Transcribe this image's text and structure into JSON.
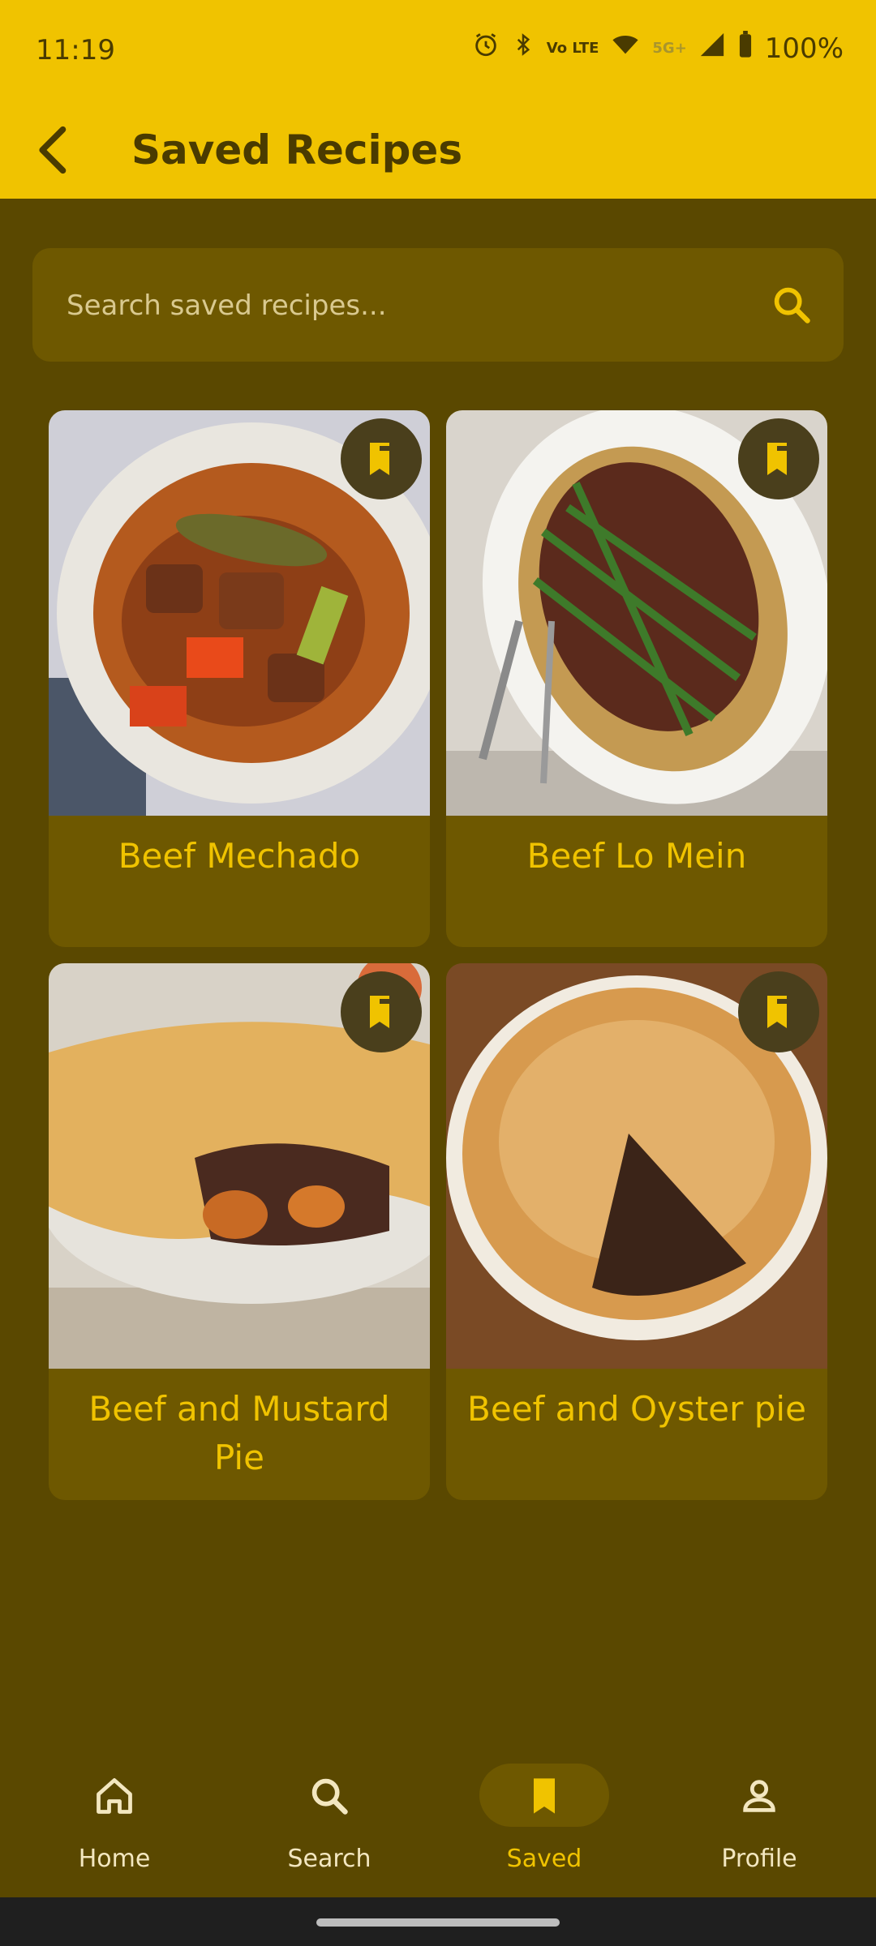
{
  "status": {
    "time": "11:19",
    "network": "5G+",
    "volte": "Vo LTE",
    "battery": "100%"
  },
  "appbar": {
    "title": "Saved Recipes"
  },
  "search": {
    "placeholder": "Search saved recipes..."
  },
  "recipes": [
    {
      "title": "Beef Mechado",
      "image": "beef-stew-bowl"
    },
    {
      "title": "Beef Lo Mein",
      "image": "beef-asparagus-noodles-platter"
    },
    {
      "title": "Beef and Mustard Pie",
      "image": "beef-pie-with-crust"
    },
    {
      "title": "Beef and Oyster pie",
      "image": "oyster-pie-cut-slice"
    }
  ],
  "nav": {
    "items": [
      {
        "label": "Home",
        "icon": "home-icon"
      },
      {
        "label": "Search",
        "icon": "search-icon"
      },
      {
        "label": "Saved",
        "icon": "bookmark-icon",
        "active": true
      },
      {
        "label": "Profile",
        "icon": "person-icon"
      }
    ]
  },
  "colors": {
    "accent": "#f0c300",
    "background": "#5a4800",
    "card": "#6e5800"
  }
}
